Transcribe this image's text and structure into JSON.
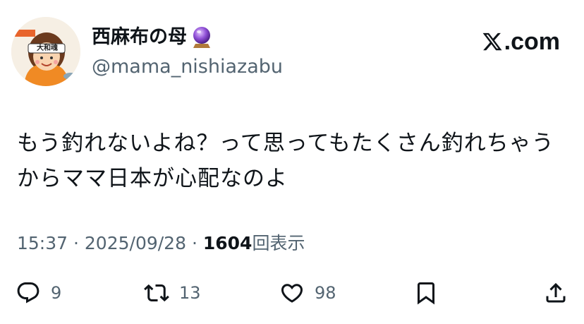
{
  "user": {
    "display_name": "西麻布の母",
    "handle": "@mama_nishiazabu",
    "avatar_headband_text": "大和魂",
    "badge_icon": "crystal-ball-icon"
  },
  "brand": {
    "label": ".com",
    "icon": "x-logo-icon"
  },
  "tweet": {
    "text": "もう釣れないよね？って思ってもたくさん釣れちゃうからママ日本が心配なのよ"
  },
  "meta": {
    "time": "15:37",
    "separator": "·",
    "date": "2025/09/28",
    "views_count": "1604",
    "views_label": "回表示"
  },
  "actions": {
    "reply_count": "9",
    "retweet_count": "13",
    "like_count": "98"
  },
  "colors": {
    "text": "#0f1419",
    "secondary": "#536471",
    "avatar_bg": "#f6efe4",
    "apron": "#f08a24"
  }
}
